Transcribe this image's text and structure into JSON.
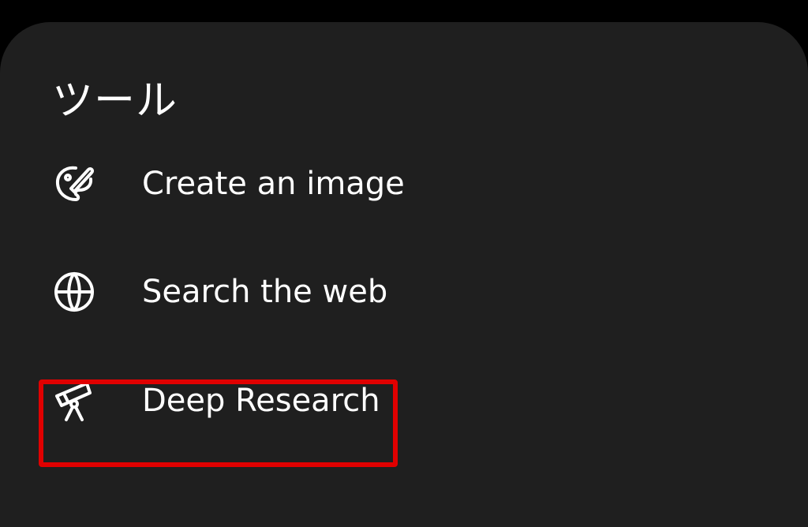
{
  "sheet": {
    "title": "ツール"
  },
  "tools": [
    {
      "label": "Create an image",
      "icon": "palette-icon"
    },
    {
      "label": "Search the web",
      "icon": "globe-icon"
    },
    {
      "label": "Deep Research",
      "icon": "telescope-icon"
    }
  ],
  "highlight": {
    "target": "Deep Research",
    "color": "#e00000"
  },
  "colors": {
    "background": "#000000",
    "sheet": "#1f1f1f",
    "text": "#ffffff"
  }
}
